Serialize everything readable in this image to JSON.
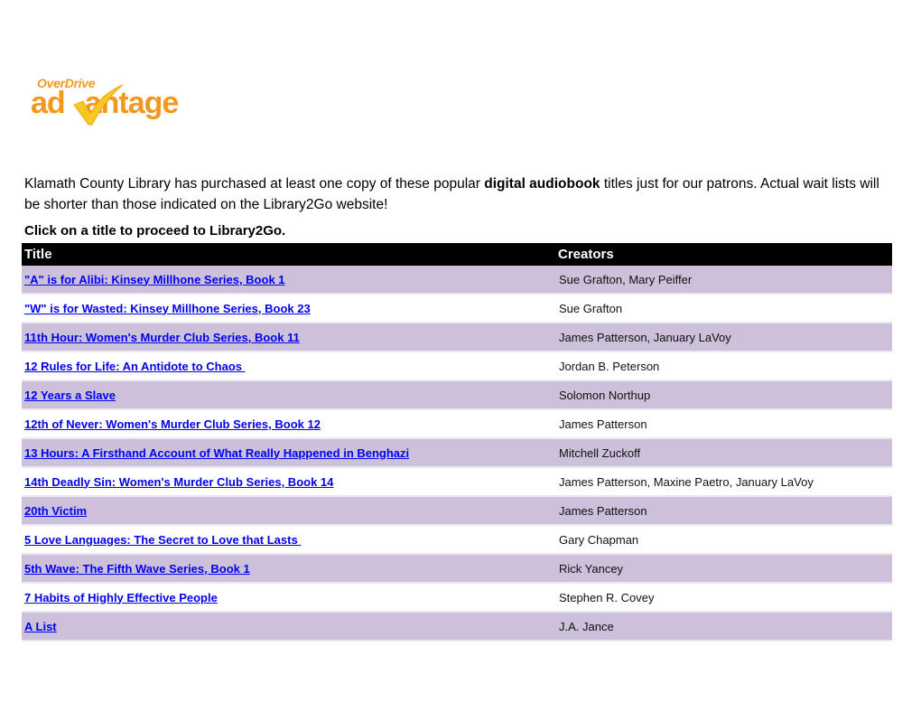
{
  "logo": {
    "top_text": "OverDrive",
    "main_text_left": "ad",
    "main_text_right": "antage",
    "icon": "checkmark-icon"
  },
  "intro": {
    "text_before": "Klamath County Library has purchased at least one copy of these popular ",
    "text_bold": "digital audiobook",
    "text_after": " titles just for our patrons. Actual wait lists will be shorter than those indicated on the Library2Go website!"
  },
  "instruction": "Click on a title to proceed to Library2Go.",
  "table": {
    "headers": [
      "Title",
      "Creators"
    ],
    "rows": [
      {
        "title": "\"A\" is for Alibi: Kinsey Millhone Series, Book 1",
        "creators": "Sue Grafton, Mary Peiffer"
      },
      {
        "title": "\"W\" is for Wasted: Kinsey Millhone Series, Book 23",
        "creators": "Sue Grafton"
      },
      {
        "title": "11th Hour: Women's Murder Club Series, Book 11",
        "creators": "James Patterson, January LaVoy"
      },
      {
        "title": "12 Rules for Life: An Antidote to Chaos ",
        "creators": "Jordan B. Peterson"
      },
      {
        "title": "12 Years a Slave",
        "creators": "Solomon Northup"
      },
      {
        "title": "12th of Never: Women's Murder Club Series, Book 12",
        "creators": "James Patterson"
      },
      {
        "title": "13 Hours: A Firsthand Account of What Really Happened in Benghazi",
        "creators": "Mitchell Zuckoff"
      },
      {
        "title": "14th Deadly Sin: Women's Murder Club Series, Book 14",
        "creators": "James Patterson, Maxine Paetro, January LaVoy"
      },
      {
        "title": "20th Victim",
        "creators": "James Patterson"
      },
      {
        "title": "5 Love Languages: The Secret to Love that Lasts ",
        "creators": "Gary Chapman"
      },
      {
        "title": "5th Wave: The Fifth Wave Series, Book 1",
        "creators": "Rick Yancey"
      },
      {
        "title": "7 Habits of Highly Effective People",
        "creators": "Stephen R. Covey"
      },
      {
        "title": "A List",
        "creators": "J.A. Jance"
      }
    ]
  },
  "colors": {
    "brand_orange": "#f2981e",
    "check_yellow": "#f7c823",
    "row_shade": "#ccc0da",
    "link": "#0000ee",
    "header_bg": "#000000"
  }
}
